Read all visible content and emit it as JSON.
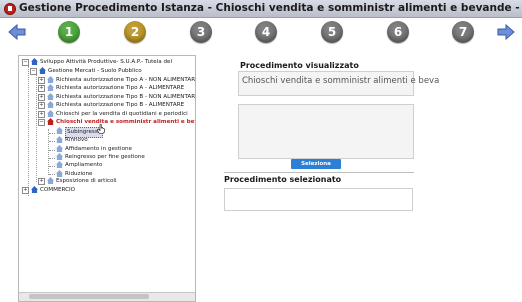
{
  "window": {
    "title": "Gestione Procedimento Istanza - Chioschi vendita e somministr alimenti e bevande - Sig."
  },
  "steps": [
    {
      "label": "1",
      "color": "#3a9b2a"
    },
    {
      "label": "2",
      "color": "#b58a12"
    },
    {
      "label": "3",
      "color": "#666666"
    },
    {
      "label": "4",
      "color": "#666666"
    },
    {
      "label": "5",
      "color": "#666666"
    },
    {
      "label": "6",
      "color": "#666666"
    },
    {
      "label": "7",
      "color": "#666666"
    }
  ],
  "tree": {
    "root": "Sviluppo Attività Produttive- S.U.A.P.- Tutela del",
    "gestione": "Gestione Mercati - Suolo Pubblico",
    "items": [
      "Richiesta autorizzazione Tipo A - NON ALIMENTARE",
      "Richiesta autorizzazione Tipo A - ALIMENTARE",
      "Richiesta autorizzazione Tipo B - NON ALIMENTARE",
      "Richiesta autorizzazione Tipo B - ALIMENTARE",
      "Chioschi per la vendita di quotidiani e periodici"
    ],
    "selected": "Chioschi vendita e somministr alimenti e bevand",
    "children": [
      "Subingresso",
      "Rinnovo",
      "Affidamento in gestione",
      "Reingresso per fine gestione",
      "Ampliamento",
      "Riduzione"
    ],
    "esposizione": "Esposizione di articoli",
    "commercio": "COMMERCIO"
  },
  "right": {
    "visualizzato_title": "Procedimento visualizzato",
    "visualizzato_value": "Chioschi vendita e somministr alimenti e beva",
    "seleziona_label": "Seleziona",
    "selezionato_title": "Procedimento selezionato"
  }
}
